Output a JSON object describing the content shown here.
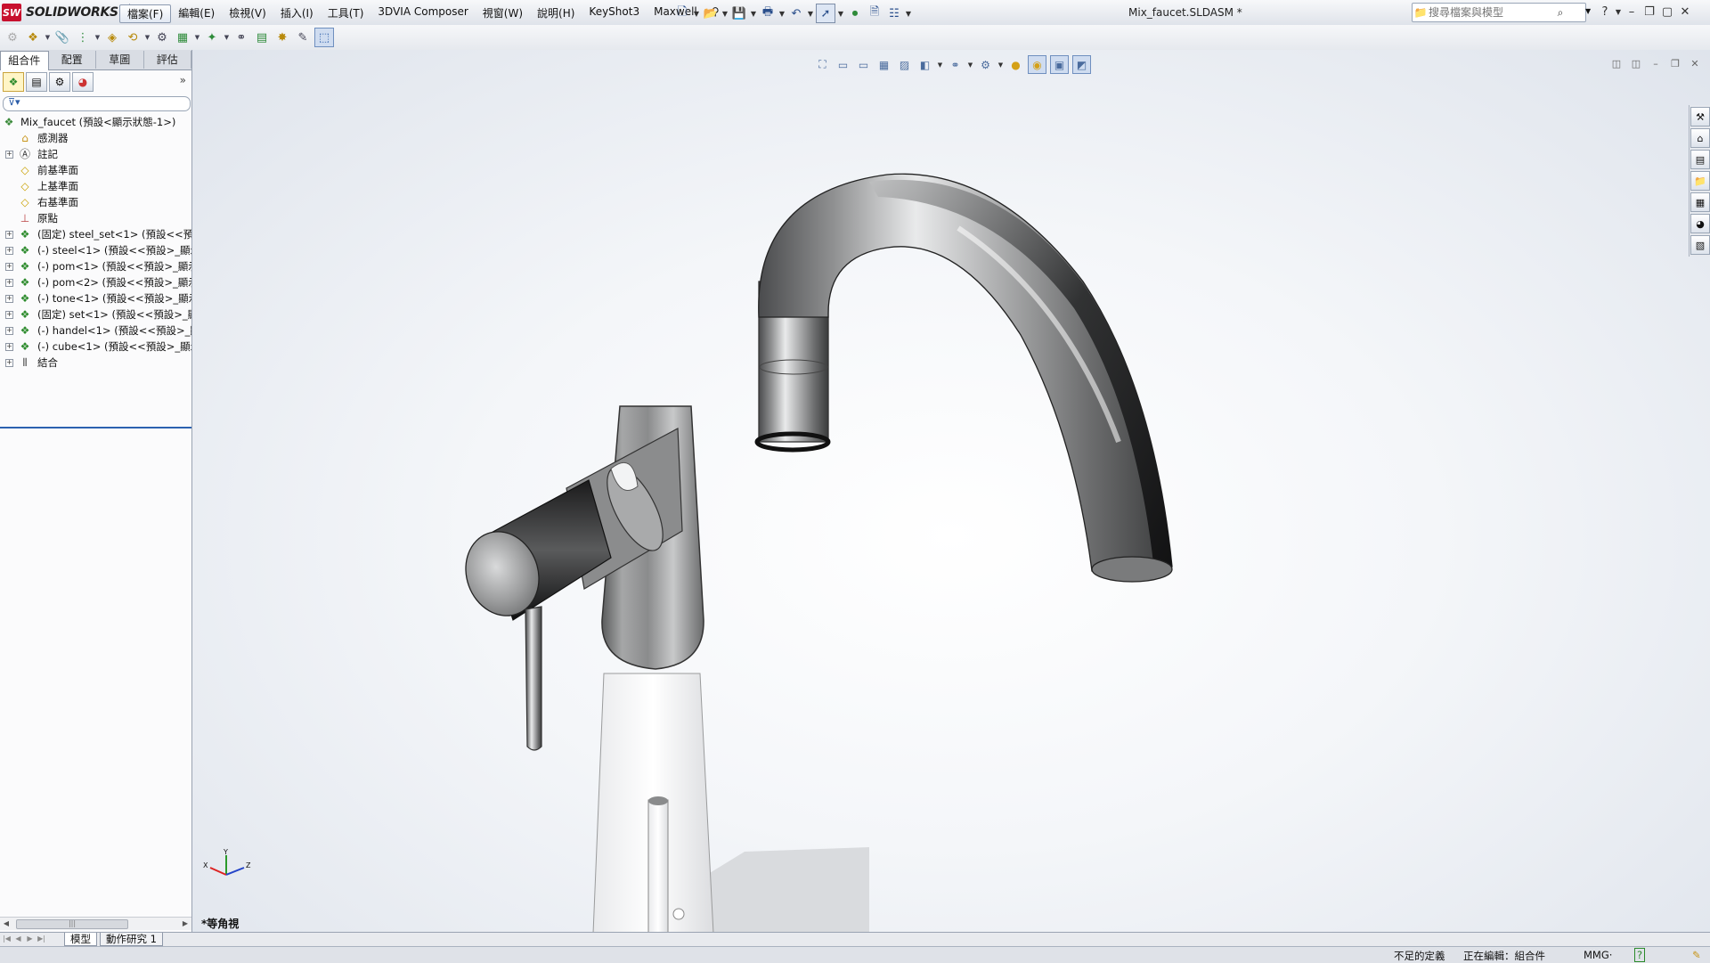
{
  "app": {
    "logo_badge": "SW",
    "logo_text": "SOLIDWORKS",
    "document_title": "Mix_faucet.SLDASM *"
  },
  "menus": [
    "檔案(F)",
    "編輯(E)",
    "檢視(V)",
    "插入(I)",
    "工具(T)",
    "3DVIA Composer",
    "視窗(W)",
    "說明(H)",
    "KeyShot3",
    "Maxwell"
  ],
  "search": {
    "placeholder": "搜尋檔案與模型",
    "value": ""
  },
  "commandmanager_tabs": [
    "組合件",
    "配置",
    "草圖",
    "評估"
  ],
  "feature_tree": {
    "root": "Mix_faucet (預設<顯示狀態-1>)",
    "items": [
      {
        "label": "感測器",
        "icon": "sensor-folder-icon",
        "expandable": false
      },
      {
        "label": "註記",
        "icon": "annotations-icon",
        "expandable": true
      },
      {
        "label": "前基準面",
        "icon": "plane-icon",
        "expandable": false
      },
      {
        "label": "上基準面",
        "icon": "plane-icon",
        "expandable": false
      },
      {
        "label": "右基準面",
        "icon": "plane-icon",
        "expandable": false
      },
      {
        "label": "原點",
        "icon": "origin-icon",
        "expandable": false
      },
      {
        "label": "(固定) steel_set<1> (預設<<預設",
        "icon": "part-icon",
        "expandable": true
      },
      {
        "label": "(-) steel<1> (預設<<預設>_顯示",
        "icon": "part-icon",
        "expandable": true
      },
      {
        "label": "(-) pom<1> (預設<<預設>_顯示",
        "icon": "part-icon",
        "expandable": true
      },
      {
        "label": "(-) pom<2> (預設<<預設>_顯示",
        "icon": "part-icon",
        "expandable": true
      },
      {
        "label": "(-) tone<1> (預設<<預設>_顯示",
        "icon": "part-icon",
        "expandable": true
      },
      {
        "label": "(固定) set<1> (預設<<預設>_顯",
        "icon": "part-icon",
        "expandable": true
      },
      {
        "label": "(-) handel<1> (預設<<預設>_顯",
        "icon": "part-icon",
        "expandable": true
      },
      {
        "label": "(-) cube<1> (預設<<預設>_顯示",
        "icon": "part-icon",
        "expandable": true
      },
      {
        "label": "結合",
        "icon": "mates-icon",
        "expandable": true
      }
    ]
  },
  "viewport": {
    "view_name": "*等角視",
    "triad_labels": {
      "x": "X",
      "y": "Y",
      "z": "Z"
    }
  },
  "bottom_tabs": [
    "模型",
    "動作研究 1"
  ],
  "status": {
    "definition": "不足的定義",
    "editing": "正在編輯：組合件",
    "units": "MMG·",
    "help": "?"
  },
  "colors": {
    "brand_red": "#c8102e",
    "selection_blue": "#2c62b0"
  }
}
